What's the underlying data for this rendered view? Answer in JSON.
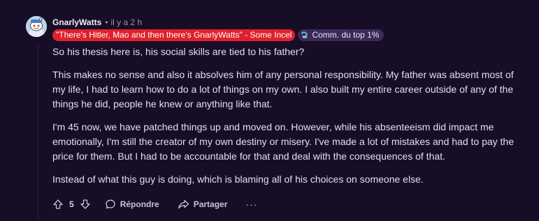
{
  "author": {
    "username": "GnarlyWatts",
    "time": "il y a 2 h"
  },
  "flairs": {
    "user_flair": "\"There's Hitler, Mao and then there's GnarlyWatts\" - Some Incel",
    "top_commenter": "Comm. du top 1%"
  },
  "body": {
    "p1": "So his thesis here is, his social skills are tied to his father?",
    "p2": "This makes no sense and also it absolves him of any personal responsibility. My father was absent most of my life, I had to learn how to do a lot of things on my own. I also built my entire career outside of any of the things he did, people he knew or anything like that.",
    "p3": "I'm 45 now, we have patched things up and moved on. However, while his absenteeism did impact me emotionally, I'm still the creator of my own destiny or misery. I've made a lot of mistakes and had to pay the price for them. But I had to be accountable for that and deal with the consequences of that.",
    "p4": "Instead of what this guy is doing, which is blaming all of his choices on someone else."
  },
  "actions": {
    "vote_count": "5",
    "reply_label": "Répondre",
    "share_label": "Partager",
    "more_label": "···"
  },
  "icons": {
    "upvote": "arrow-up-icon",
    "downvote": "arrow-down-icon",
    "reply": "speech-bubble-icon",
    "share": "share-arrow-icon",
    "more": "ellipsis-icon",
    "top_commenter": "top-commenter-icon",
    "avatar": "snoo-avatar"
  },
  "colors": {
    "background": "#170d26",
    "user_flair_bg": "#e0202c",
    "top_flair_bg": "#3a2a57",
    "meta_text": "#9c92ad"
  }
}
